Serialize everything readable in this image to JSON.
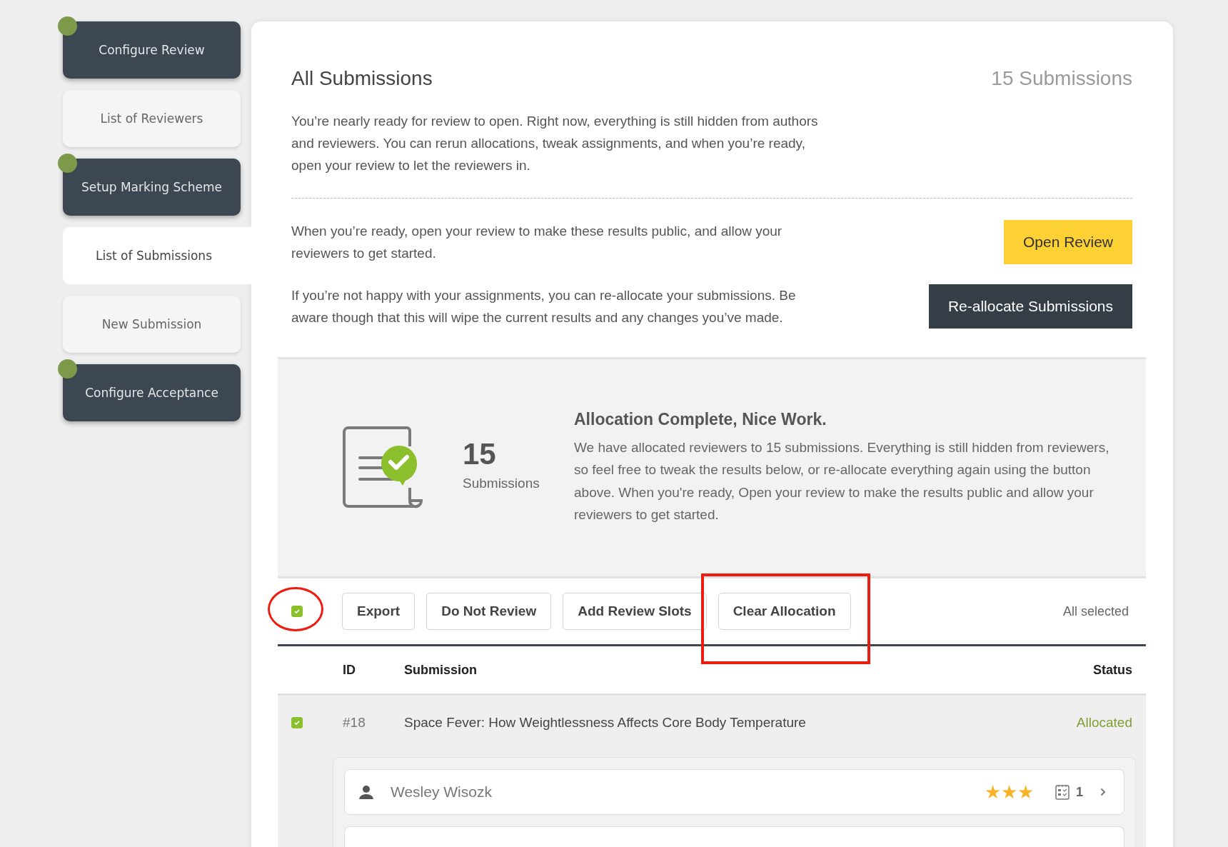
{
  "sidebar": {
    "items": [
      {
        "label": "Configure Review",
        "completed": true,
        "selected": false
      },
      {
        "label": "List of Reviewers",
        "completed": false,
        "selected": false
      },
      {
        "label": "Setup Marking Scheme",
        "completed": true,
        "selected": false
      },
      {
        "label": "List of Submissions",
        "completed": false,
        "selected": true
      },
      {
        "label": "New Submission",
        "completed": false,
        "selected": false
      },
      {
        "label": "Configure Acceptance",
        "completed": true,
        "selected": false
      }
    ]
  },
  "header": {
    "title": "All Submissions",
    "count": "15 Submissions",
    "intro": "You’re nearly ready for review to open. Right now, everything is still hidden from authors and reviewers. You can rerun allocations, tweak assignments, and when you’re ready, open your review to let the reviewers in."
  },
  "actions": [
    {
      "text": "When you’re ready, open your review to make these results public, and allow your reviewers to get started.",
      "button": "Open Review",
      "kind": "primary"
    },
    {
      "text": "If you’re not happy with your assignments, you can re-allocate your submissions. Be aware though that this will wipe the current results and any changes you’ve made.",
      "button": "Re-allocate Submissions",
      "kind": "dark"
    }
  ],
  "summary": {
    "number": "15",
    "unit": "Submissions",
    "heading": "Allocation Complete, Nice Work.",
    "body": "We have allocated reviewers to 15 submissions. Everything is still hidden from reviewers, so feel free to tweak the results below, or re-allocate everything again using the button above. When you're ready, Open your review to make the results public and allow your reviewers to get started."
  },
  "toolbar": {
    "select_all_checked": true,
    "buttons": [
      "Export",
      "Do Not Review",
      "Add Review Slots",
      "Clear Allocation"
    ],
    "selection_note": "All selected"
  },
  "table": {
    "columns": [
      "ID",
      "Submission",
      "Status"
    ],
    "rows": [
      {
        "checked": true,
        "id": "#18",
        "title": "Space Fever: How Weightlessness Affects Core Body Temperature",
        "status": "Allocated",
        "reviewers": [
          {
            "name": "Wesley Wisozk",
            "stars": 3,
            "count": "1"
          }
        ]
      }
    ]
  },
  "annotations": [
    {
      "kind": "circle"
    },
    {
      "kind": "rectangle"
    }
  ]
}
